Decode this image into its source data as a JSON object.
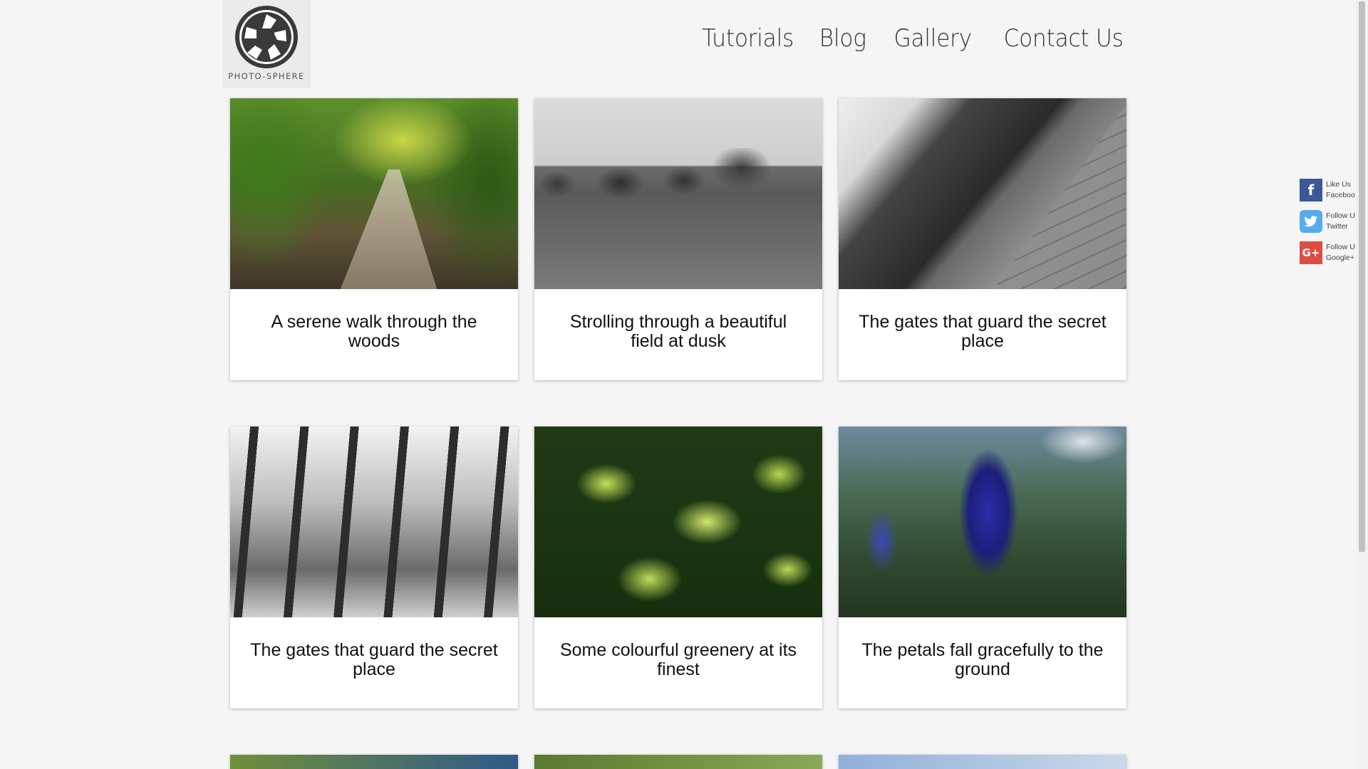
{
  "brand": {
    "logo_text": "PHOTO-SPHERE"
  },
  "nav": {
    "items": [
      {
        "label": "Tutorials"
      },
      {
        "label": "Blog"
      },
      {
        "label": "Gallery"
      },
      {
        "label": "Contact Us"
      }
    ]
  },
  "gallery": {
    "cards": [
      {
        "caption": "A serene walk through the woods"
      },
      {
        "caption": "Strolling through a beautiful field at dusk"
      },
      {
        "caption": "The gates that guard the secret place"
      },
      {
        "caption": "The gates that guard the secret place"
      },
      {
        "caption": "Some colourful greenery at its finest"
      },
      {
        "caption": "The petals fall gracefully to the ground"
      }
    ]
  },
  "social": {
    "facebook": {
      "line1": "Like Us",
      "line2": "Facebook",
      "icon": "facebook-icon",
      "color": "#3b5998"
    },
    "twitter": {
      "line1": "Follow Us",
      "line2": "Twitter",
      "icon": "twitter-icon",
      "color": "#55acee"
    },
    "google": {
      "line1": "Follow Us",
      "line2": "Google+",
      "icon": "google-plus-icon",
      "color": "#dc4e41"
    }
  }
}
